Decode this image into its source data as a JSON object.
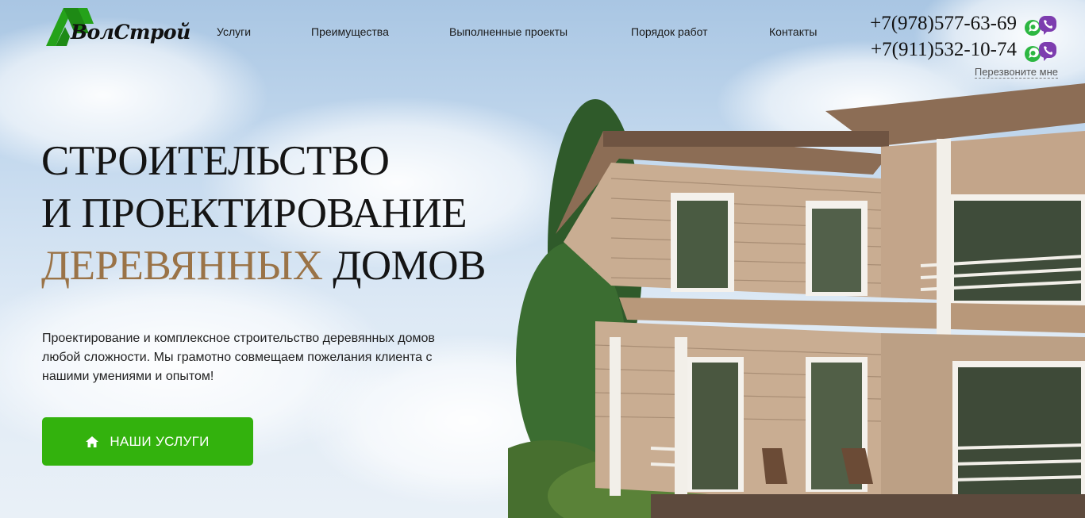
{
  "brand": {
    "name": "ВолСтрой",
    "green": "#25a21a",
    "accent": "#9a7347"
  },
  "nav": [
    {
      "label": "Услуги"
    },
    {
      "label": "Преимущества"
    },
    {
      "label": "Выполненные проекты"
    },
    {
      "label": "Порядок работ"
    },
    {
      "label": "Контакты"
    }
  ],
  "contacts": {
    "phones": [
      "+7(978)577-63-69",
      "+7(911)532-10-74"
    ],
    "messenger_icons": [
      "whatsapp-icon",
      "viber-icon"
    ],
    "callback_label": "Перезвоните мне"
  },
  "hero": {
    "title_line1": "СТРОИТЕЛЬСТВО",
    "title_line2": "И ПРОЕКТИРОВАНИЕ",
    "title_accent": "ДЕРЕВЯННЫХ",
    "title_end": " ДОМОВ",
    "lead": "Проектирование и комплексное строительство деревянных домов любой сложности. Мы грамотно совмещаем пожелания клиента с нашими умениями и опытом!",
    "cta_label": "НАШИ УСЛУГИ",
    "cta_icon": "home-icon",
    "cta_color": "#33b20d"
  }
}
